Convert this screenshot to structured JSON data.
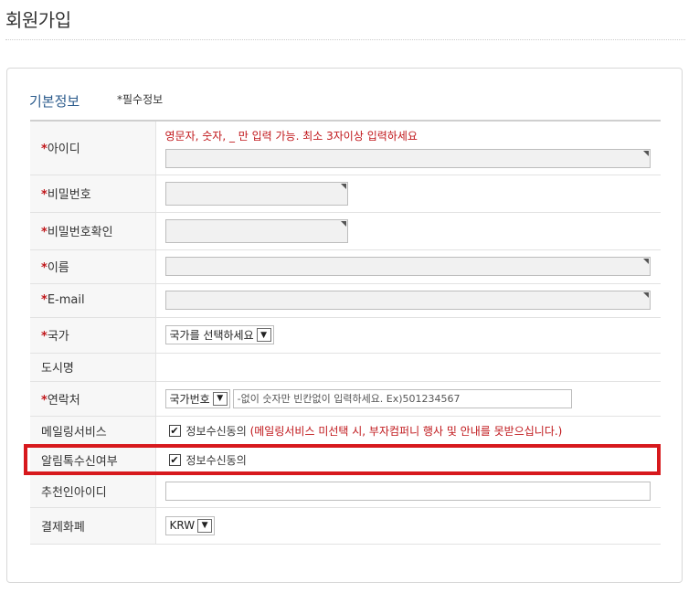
{
  "page": {
    "title": "회원가입"
  },
  "section": {
    "title": "기본정보",
    "required_note": "*필수정보"
  },
  "form": {
    "required_mark": "*",
    "rows": {
      "userid": {
        "label": "아이디",
        "hint": "영문자, 숫자, _ 만 입력 가능. 최소 3자이상 입력하세요",
        "value": ""
      },
      "password": {
        "label": "비밀번호",
        "value": ""
      },
      "password_confirm": {
        "label": "비밀번호확인",
        "value": ""
      },
      "name": {
        "label": "이름",
        "value": ""
      },
      "email": {
        "label": "E-mail",
        "value": ""
      },
      "country": {
        "label": "국가",
        "selected": "국가를 선택하세요"
      },
      "city": {
        "label": "도시명"
      },
      "contact": {
        "label": "연락처",
        "code_selected": "국가번호",
        "placeholder": "-없이 숫자만 빈칸없이 입력하세요. Ex)501234567"
      },
      "mailing": {
        "label": "메일링서비스",
        "checked": true,
        "option_label": "정보수신동의",
        "note": "(메일링서비스 미선택 시, 부자컴퍼니 행사 및 안내를 못받으십니다.)"
      },
      "sms": {
        "label": "알림톡수신여부",
        "checked": true,
        "option_label": "정보수신동의"
      },
      "referrer": {
        "label": "추천인아이디",
        "value": ""
      },
      "currency": {
        "label": "결제화폐",
        "selected": "KRW"
      }
    }
  },
  "icons": {
    "checkbox": "checkmark-icon",
    "dropdown": "chevron-down-icon"
  },
  "colors": {
    "required": "#c0171b",
    "section_title": "#2b5b8c",
    "highlight": "#d7191d"
  }
}
